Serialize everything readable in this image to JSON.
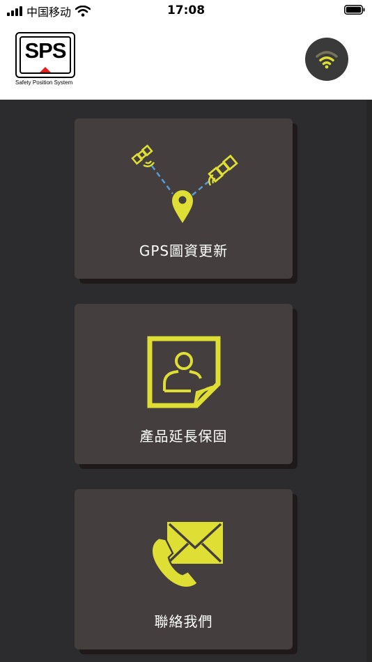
{
  "status_bar": {
    "carrier": "中国移动",
    "time": "17:08"
  },
  "header": {
    "logo_text": "SPS",
    "logo_subtitle": "Safety Position System",
    "wifi_icon": "wifi-icon"
  },
  "cards": [
    {
      "label": "GPS圖資更新",
      "icon": "satellite-location-icon"
    },
    {
      "label": "產品延長保固",
      "icon": "user-document-icon"
    },
    {
      "label": "聯絡我們",
      "icon": "mail-phone-icon"
    }
  ],
  "colors": {
    "accent": "#dede34",
    "card_bg": "#443f3e",
    "page_bg": "#2c2c2e",
    "dash_line": "#5b9bd5"
  }
}
